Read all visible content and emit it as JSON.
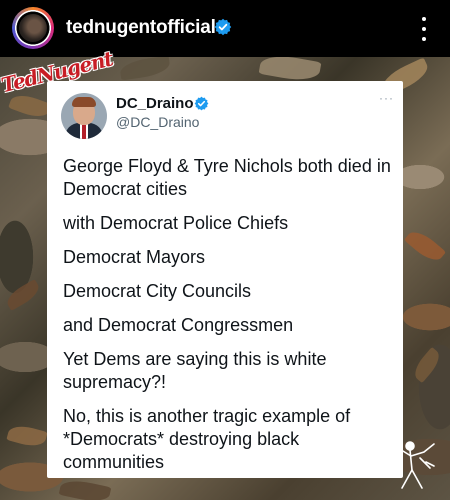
{
  "post": {
    "username": "tednugentofficial",
    "logo_text": "TedNugent"
  },
  "tweet": {
    "display_name": "DC_Draino",
    "handle": "@DC_Draino",
    "more": "···",
    "paragraphs": [
      "George Floyd & Tyre Nichols both died in Democrat cities",
      "with Democrat Police Chiefs",
      "Democrat Mayors",
      "Democrat City Councils",
      "and Democrat Congressmen",
      "Yet Dems are saying this is white supremacy?!",
      "No, this is another tragic example of *Democrats* destroying black communities"
    ]
  },
  "colors": {
    "verified": "#1d9bf0",
    "logo": "#c81d25",
    "header_bg": "#000000"
  }
}
